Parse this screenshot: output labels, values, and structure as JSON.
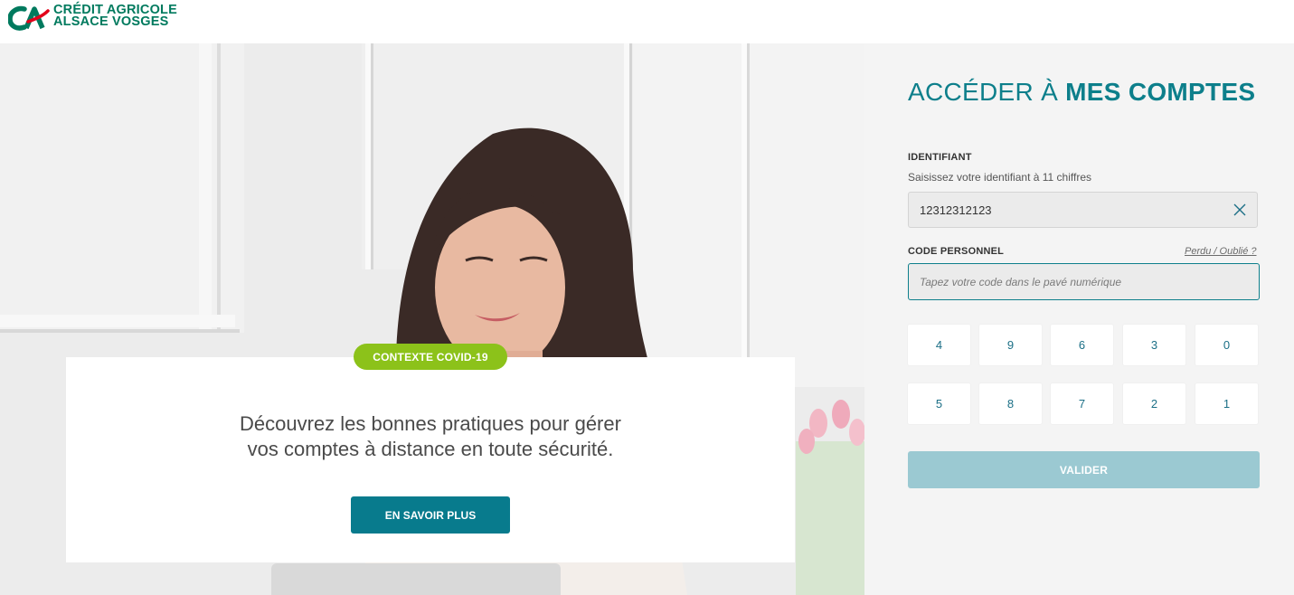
{
  "brand": {
    "line1": "CRÉDIT AGRICOLE",
    "line2": "ALSACE VOSGES",
    "color": "#007a5e",
    "accent": "#e2001a"
  },
  "hero": {
    "badge": "CONTEXTE COVID-19",
    "text_line1": "Découvrez les bonnes pratiques pour gérer",
    "text_line2": "vos comptes à distance en toute sécurité.",
    "button": "EN SAVOIR PLUS"
  },
  "login": {
    "title_light": "ACCÉDER À",
    "title_bold": "MES COMPTES",
    "identifier": {
      "label": "IDENTIFIANT",
      "hint": "Saisissez votre identifiant à 11 chiffres",
      "value": "12312312123",
      "clear_icon": "close-icon"
    },
    "code": {
      "label": "CODE PERSONNEL",
      "forgot": "Perdu / Oublié ?",
      "placeholder": "Tapez votre code dans le pavé numérique"
    },
    "keypad": [
      "4",
      "9",
      "6",
      "3",
      "0",
      "5",
      "8",
      "7",
      "2",
      "1"
    ],
    "validate": "VALIDER"
  },
  "colors": {
    "teal": "#087b8d",
    "title": "#0d7f8b",
    "badge_green": "#8cc21a",
    "validate_disabled": "#9bc9d2",
    "panel_bg": "#f4f4f4"
  }
}
